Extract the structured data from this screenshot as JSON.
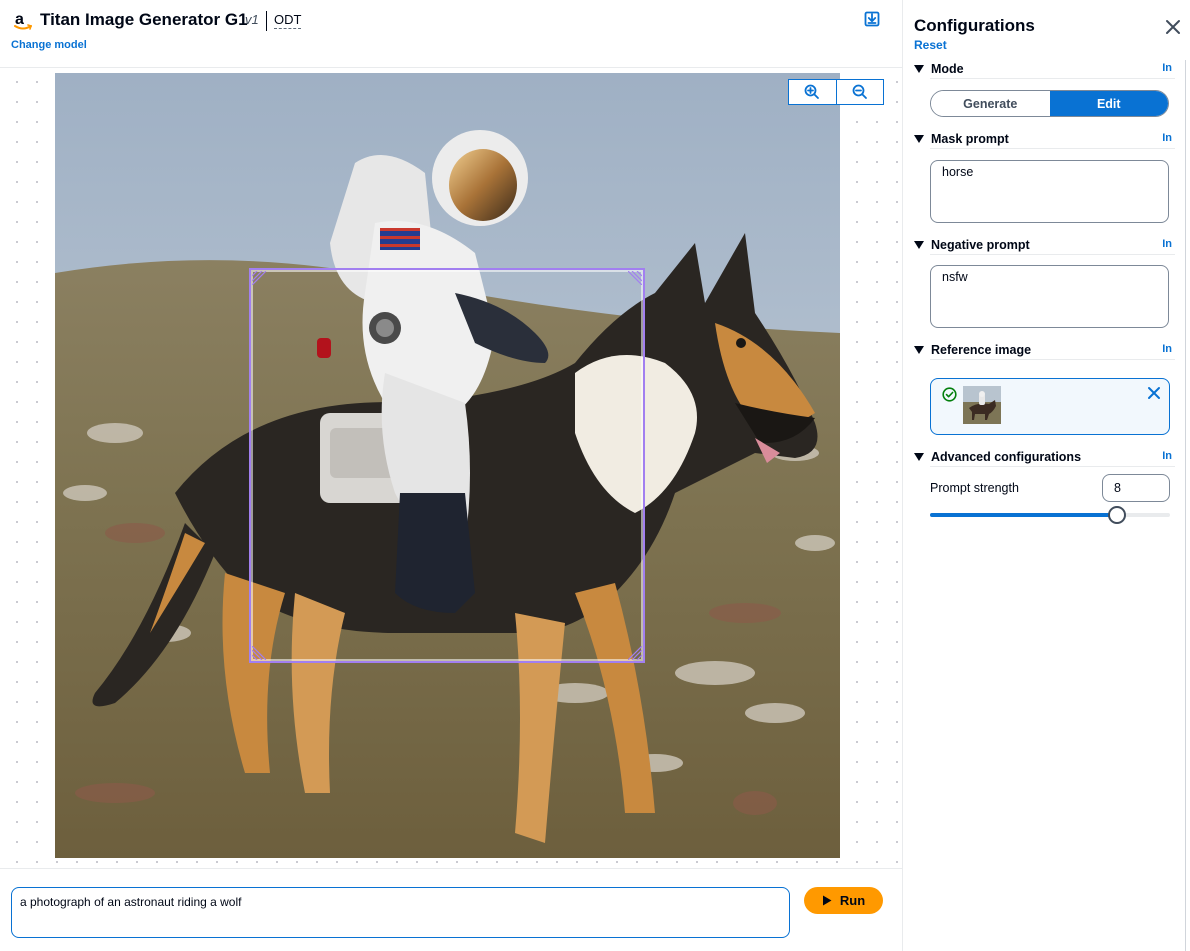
{
  "header": {
    "title": "Titan Image Generator G1",
    "version": "v1",
    "region": "ODT",
    "change_model": "Change model"
  },
  "image": {
    "alt": "a photograph of an astronaut riding a wolf"
  },
  "prompt": {
    "value": "a photograph of an astronaut riding a wolf",
    "run_label": "Run"
  },
  "config": {
    "title": "Configurations",
    "reset": "Reset",
    "info": "In",
    "mode": {
      "label": "Mode",
      "options": [
        "Generate",
        "Edit"
      ],
      "selected": "Edit"
    },
    "mask_prompt": {
      "label": "Mask prompt",
      "value": "horse"
    },
    "negative_prompt": {
      "label": "Negative prompt",
      "value": "nsfw"
    },
    "reference_image": {
      "label": "Reference image"
    },
    "advanced": {
      "label": "Advanced configurations",
      "prompt_strength_label": "Prompt strength",
      "prompt_strength_value": "8",
      "prompt_strength_fraction": 0.78
    }
  },
  "colors": {
    "accent": "#0972d3",
    "run": "#ff9900",
    "mask": "#a27ff0"
  }
}
